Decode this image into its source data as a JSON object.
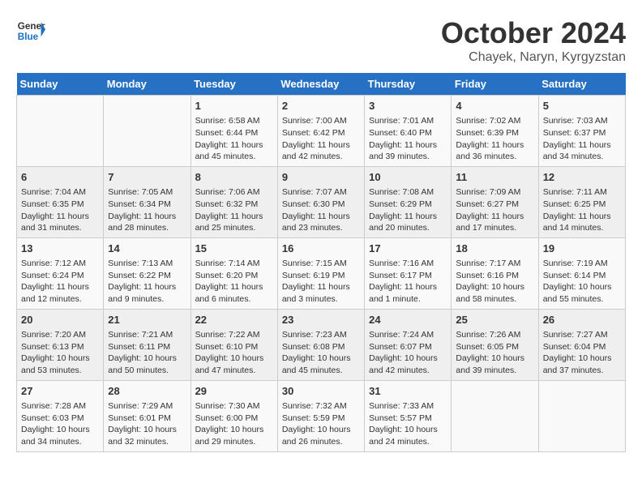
{
  "header": {
    "logo_line1": "General",
    "logo_line2": "Blue",
    "month": "October 2024",
    "location": "Chayek, Naryn, Kyrgyzstan"
  },
  "weekdays": [
    "Sunday",
    "Monday",
    "Tuesday",
    "Wednesday",
    "Thursday",
    "Friday",
    "Saturday"
  ],
  "rows": [
    [
      {
        "day": "",
        "content": ""
      },
      {
        "day": "",
        "content": ""
      },
      {
        "day": "1",
        "content": "Sunrise: 6:58 AM\nSunset: 6:44 PM\nDaylight: 11 hours and 45 minutes."
      },
      {
        "day": "2",
        "content": "Sunrise: 7:00 AM\nSunset: 6:42 PM\nDaylight: 11 hours and 42 minutes."
      },
      {
        "day": "3",
        "content": "Sunrise: 7:01 AM\nSunset: 6:40 PM\nDaylight: 11 hours and 39 minutes."
      },
      {
        "day": "4",
        "content": "Sunrise: 7:02 AM\nSunset: 6:39 PM\nDaylight: 11 hours and 36 minutes."
      },
      {
        "day": "5",
        "content": "Sunrise: 7:03 AM\nSunset: 6:37 PM\nDaylight: 11 hours and 34 minutes."
      }
    ],
    [
      {
        "day": "6",
        "content": "Sunrise: 7:04 AM\nSunset: 6:35 PM\nDaylight: 11 hours and 31 minutes."
      },
      {
        "day": "7",
        "content": "Sunrise: 7:05 AM\nSunset: 6:34 PM\nDaylight: 11 hours and 28 minutes."
      },
      {
        "day": "8",
        "content": "Sunrise: 7:06 AM\nSunset: 6:32 PM\nDaylight: 11 hours and 25 minutes."
      },
      {
        "day": "9",
        "content": "Sunrise: 7:07 AM\nSunset: 6:30 PM\nDaylight: 11 hours and 23 minutes."
      },
      {
        "day": "10",
        "content": "Sunrise: 7:08 AM\nSunset: 6:29 PM\nDaylight: 11 hours and 20 minutes."
      },
      {
        "day": "11",
        "content": "Sunrise: 7:09 AM\nSunset: 6:27 PM\nDaylight: 11 hours and 17 minutes."
      },
      {
        "day": "12",
        "content": "Sunrise: 7:11 AM\nSunset: 6:25 PM\nDaylight: 11 hours and 14 minutes."
      }
    ],
    [
      {
        "day": "13",
        "content": "Sunrise: 7:12 AM\nSunset: 6:24 PM\nDaylight: 11 hours and 12 minutes."
      },
      {
        "day": "14",
        "content": "Sunrise: 7:13 AM\nSunset: 6:22 PM\nDaylight: 11 hours and 9 minutes."
      },
      {
        "day": "15",
        "content": "Sunrise: 7:14 AM\nSunset: 6:20 PM\nDaylight: 11 hours and 6 minutes."
      },
      {
        "day": "16",
        "content": "Sunrise: 7:15 AM\nSunset: 6:19 PM\nDaylight: 11 hours and 3 minutes."
      },
      {
        "day": "17",
        "content": "Sunrise: 7:16 AM\nSunset: 6:17 PM\nDaylight: 11 hours and 1 minute."
      },
      {
        "day": "18",
        "content": "Sunrise: 7:17 AM\nSunset: 6:16 PM\nDaylight: 10 hours and 58 minutes."
      },
      {
        "day": "19",
        "content": "Sunrise: 7:19 AM\nSunset: 6:14 PM\nDaylight: 10 hours and 55 minutes."
      }
    ],
    [
      {
        "day": "20",
        "content": "Sunrise: 7:20 AM\nSunset: 6:13 PM\nDaylight: 10 hours and 53 minutes."
      },
      {
        "day": "21",
        "content": "Sunrise: 7:21 AM\nSunset: 6:11 PM\nDaylight: 10 hours and 50 minutes."
      },
      {
        "day": "22",
        "content": "Sunrise: 7:22 AM\nSunset: 6:10 PM\nDaylight: 10 hours and 47 minutes."
      },
      {
        "day": "23",
        "content": "Sunrise: 7:23 AM\nSunset: 6:08 PM\nDaylight: 10 hours and 45 minutes."
      },
      {
        "day": "24",
        "content": "Sunrise: 7:24 AM\nSunset: 6:07 PM\nDaylight: 10 hours and 42 minutes."
      },
      {
        "day": "25",
        "content": "Sunrise: 7:26 AM\nSunset: 6:05 PM\nDaylight: 10 hours and 39 minutes."
      },
      {
        "day": "26",
        "content": "Sunrise: 7:27 AM\nSunset: 6:04 PM\nDaylight: 10 hours and 37 minutes."
      }
    ],
    [
      {
        "day": "27",
        "content": "Sunrise: 7:28 AM\nSunset: 6:03 PM\nDaylight: 10 hours and 34 minutes."
      },
      {
        "day": "28",
        "content": "Sunrise: 7:29 AM\nSunset: 6:01 PM\nDaylight: 10 hours and 32 minutes."
      },
      {
        "day": "29",
        "content": "Sunrise: 7:30 AM\nSunset: 6:00 PM\nDaylight: 10 hours and 29 minutes."
      },
      {
        "day": "30",
        "content": "Sunrise: 7:32 AM\nSunset: 5:59 PM\nDaylight: 10 hours and 26 minutes."
      },
      {
        "day": "31",
        "content": "Sunrise: 7:33 AM\nSunset: 5:57 PM\nDaylight: 10 hours and 24 minutes."
      },
      {
        "day": "",
        "content": ""
      },
      {
        "day": "",
        "content": ""
      }
    ]
  ]
}
